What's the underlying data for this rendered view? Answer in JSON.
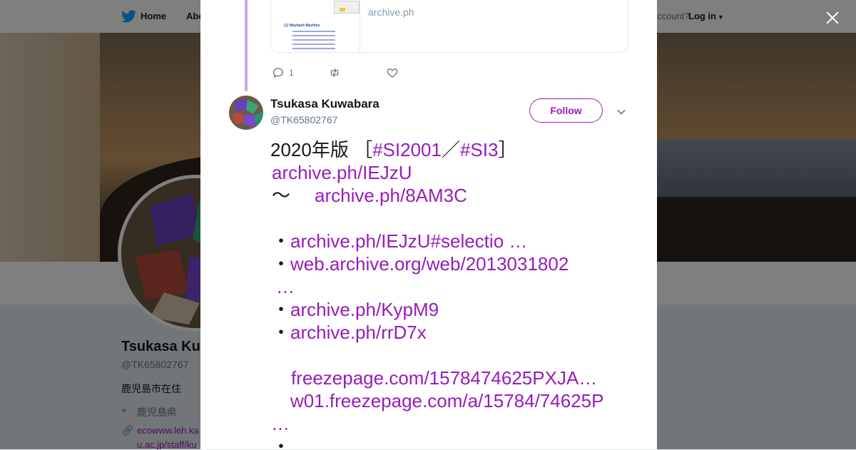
{
  "topnav": {
    "home_label": "Home",
    "about_label": "Abo",
    "account_question": "ccount?",
    "login_label": "Log in"
  },
  "profile": {
    "name": "Tsukasa Ku",
    "handle": "@TK65802767",
    "bio": "鹿児島市在住",
    "location": "鹿児島県",
    "url_line1": "ecowww.leh.ka",
    "url_line2": "u.ac.jp/staff/ku"
  },
  "card": {
    "domain": "archive.ph",
    "thumb_title": "(1) Wayback Machine"
  },
  "prev_tweet_actions": {
    "reply_count": "1"
  },
  "tweet": {
    "user_name": "Tsukasa Kuwabara",
    "user_handle": "@TK65802767",
    "follow_label": "Follow",
    "line1": {
      "prefix": "2020年版 ［",
      "tag1": "#SI2001",
      "sep": "／",
      "tag2": "#SI3",
      "suffix": "］"
    },
    "line2_link": "archive.ph/IEJzU",
    "line3_prefix": "～　",
    "line3_link": "archive.ph/8AM3C",
    "bullet": "・",
    "item1_link": "archive.ph/IEJzU#selectio …",
    "item2_link": "web.archive.org/web/2013031802",
    "item2_cont": "…",
    "item3_link": "archive.ph/KypM9",
    "item4_link": "archive.ph/rrD7x",
    "item5_link": "freezepage.com/1578474625PXJA…",
    "item6_link": "w01.freezepage.com/a/15784/74625P",
    "item6_cont": "…",
    "last_bullet": "・"
  },
  "colors": {
    "link": "#981cb8",
    "thread_line": "#c7a7e8",
    "twitter_blue": "#1da1f2"
  }
}
